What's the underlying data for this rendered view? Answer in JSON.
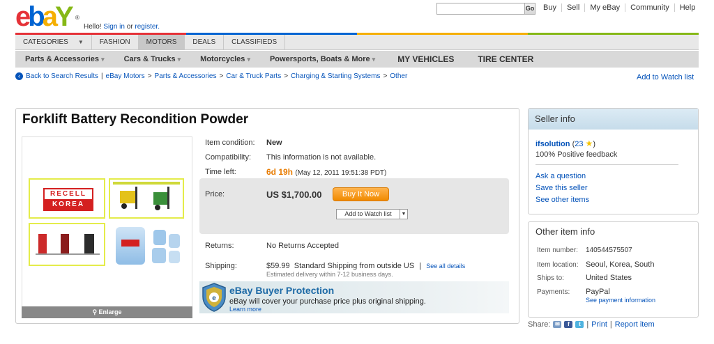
{
  "header": {
    "logo": {
      "e": "e",
      "b": "b",
      "a": "a",
      "y": "Y",
      "reg": "®"
    },
    "hello_text": "Hello!",
    "signin": "Sign in",
    "or_text": "or",
    "register": "register.",
    "search_button": "Go",
    "links": [
      "Buy",
      "Sell",
      "My eBay",
      "Community",
      "Help"
    ]
  },
  "tabs": [
    {
      "label": "Categories",
      "has_arrow": true
    },
    {
      "label": "Fashion"
    },
    {
      "label": "Motors",
      "active": true
    },
    {
      "label": "Deals"
    },
    {
      "label": "Classifieds"
    }
  ],
  "subnav": [
    {
      "label": "Parts & Accessories",
      "dd": "▾"
    },
    {
      "label": "Cars & Trucks",
      "dd": "▾"
    },
    {
      "label": "Motorcycles",
      "dd": "▾"
    },
    {
      "label": "Powersports, Boats & More",
      "dd": "▾"
    },
    {
      "label": "MY VEHICLES"
    },
    {
      "label": "TIRE CENTER"
    }
  ],
  "breadcrumb": {
    "back": "Back to Search Results",
    "items": [
      "eBay Motors",
      "Parts & Accessories",
      "Car & Truck Parts",
      "Charging & Starting Systems",
      "Other"
    ]
  },
  "watch_top": "Add to Watch list",
  "item": {
    "title": "Forklift Battery Recondition Powder",
    "enlarge": "Enlarge",
    "image_brand": "RECELL",
    "image_brand2": "KOREA",
    "condition_label": "Item condition:",
    "condition_value": "New",
    "compat_label": "Compatibility:",
    "compat_value": "This information is not available.",
    "time_label": "Time left:",
    "time_value": "6d 19h",
    "time_detail": "(May 12, 2011 19:51:38 PDT)",
    "price_label": "Price:",
    "price_value": "US $1,700.00",
    "buy_label": "Buy It Now",
    "watch_label": "Add to Watch list",
    "returns_label": "Returns:",
    "returns_value": "No Returns Accepted",
    "shipping_label": "Shipping:",
    "shipping_cost": "$59.99",
    "shipping_method": "Standard Shipping from outside US",
    "shipping_details": "See all details",
    "shipping_eta": "Estimated delivery within 7-12 business days."
  },
  "protection": {
    "title": "eBay Buyer Protection",
    "text": "eBay will cover your purchase price plus original shipping.",
    "learn": "Learn more"
  },
  "seller": {
    "heading": "Seller info",
    "name": "ifsolution",
    "score": "23",
    "feedback": "100% Positive feedback",
    "ask": "Ask a question",
    "save": "Save this seller",
    "other": "See other items"
  },
  "other_info": {
    "heading": "Other item info",
    "rows": [
      {
        "label": "Item number:",
        "value": "140544575507"
      },
      {
        "label": "Item location:",
        "value": "Seoul, Korea, South"
      },
      {
        "label": "Ships to:",
        "value": "United States"
      },
      {
        "label": "Payments:",
        "value": "PayPal"
      }
    ],
    "payment_link": "See payment information"
  },
  "share": {
    "label": "Share:",
    "print": "Print",
    "report": "Report item"
  },
  "colors": {
    "ebay_red": "#e53238",
    "ebay_blue": "#0064d2",
    "ebay_yellow": "#f5af02",
    "ebay_green": "#86b817",
    "link": "#0654ba",
    "time_orange": "#e87b00"
  }
}
